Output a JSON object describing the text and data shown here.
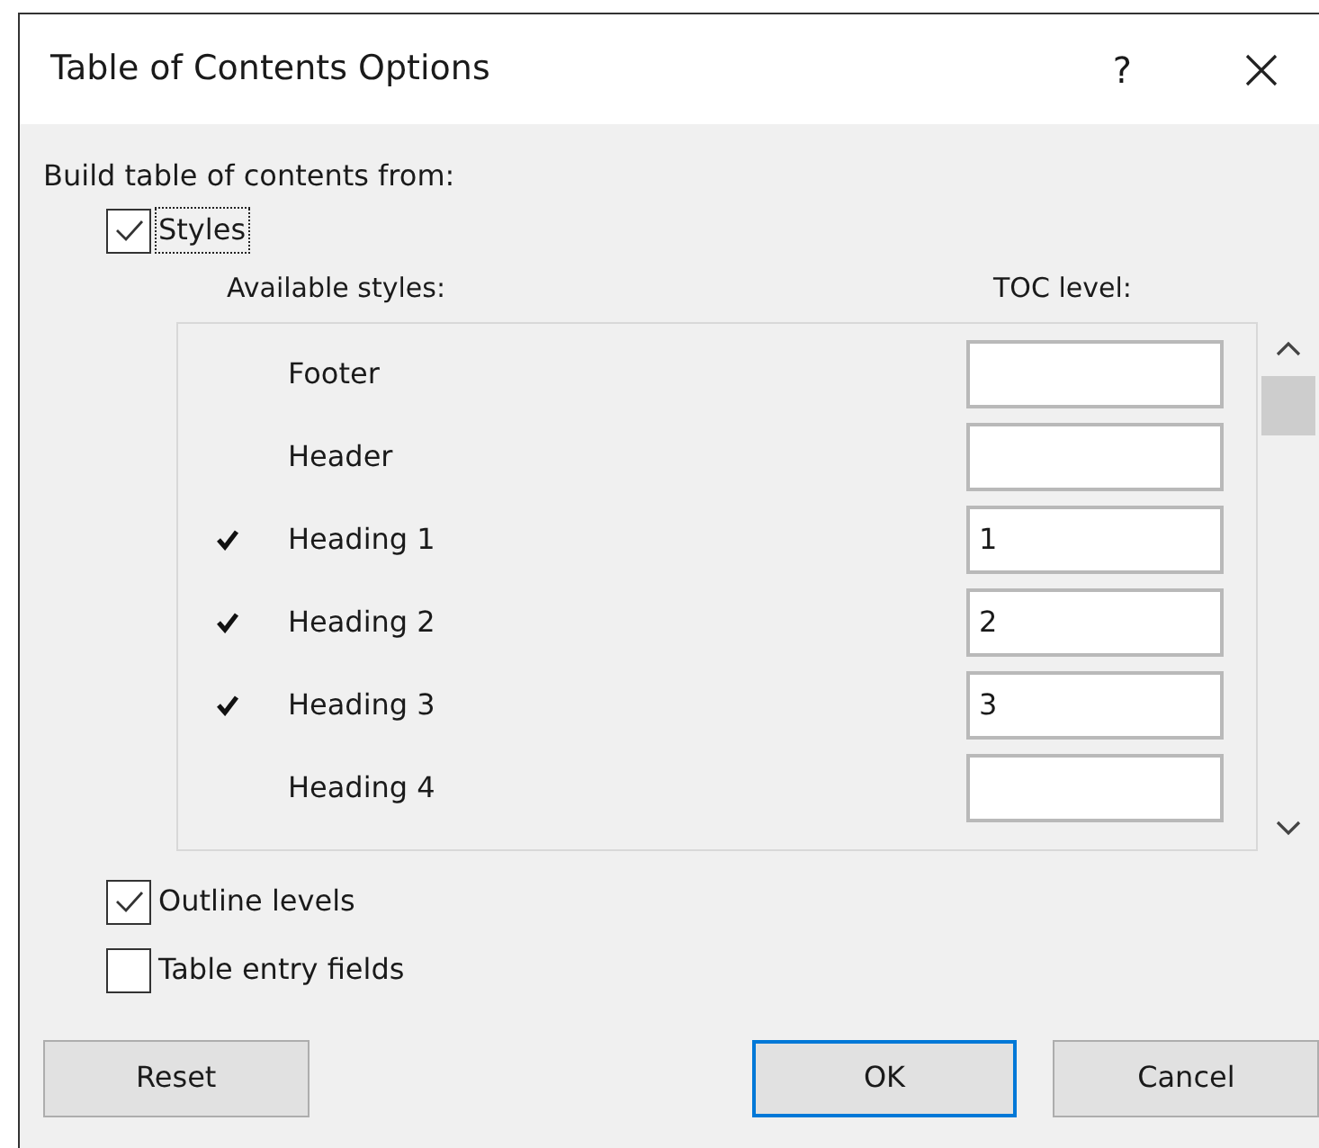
{
  "window": {
    "title": "Table of Contents Options",
    "help": "?"
  },
  "build_label": "Build table of contents from:",
  "styles_option": {
    "label": "Styles",
    "checked": true,
    "focused": true
  },
  "columns": {
    "available": "Available styles:",
    "level": "TOC level:"
  },
  "styles": [
    {
      "name": "Footer",
      "checked": false
    },
    {
      "name": "Header",
      "checked": false
    },
    {
      "name": "Heading 1",
      "checked": true,
      "level": "1"
    },
    {
      "name": "Heading 2",
      "checked": true,
      "level": "2"
    },
    {
      "name": "Heading 3",
      "checked": true,
      "level": "3"
    },
    {
      "name": "Heading 4",
      "checked": false
    }
  ],
  "options": [
    {
      "label": "Outline levels",
      "checked": true
    },
    {
      "label": "Table entry fields",
      "checked": false
    }
  ],
  "buttons": [
    {
      "label": "Reset",
      "default": false
    },
    {
      "label": "OK",
      "default": true
    },
    {
      "label": "Cancel",
      "default": false
    }
  ]
}
